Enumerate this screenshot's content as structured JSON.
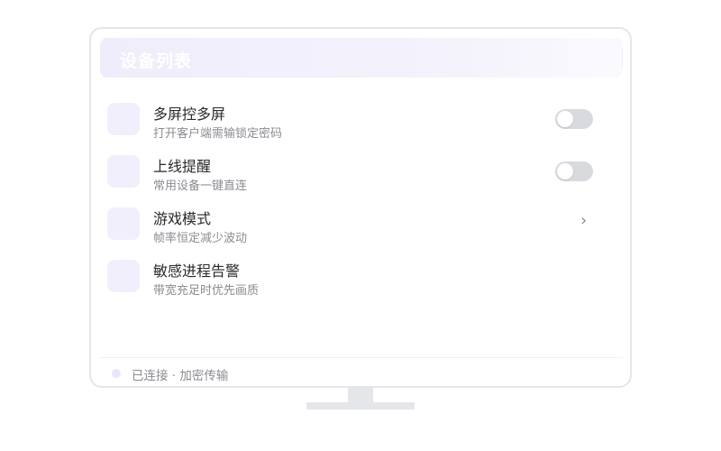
{
  "header": {
    "title": "设备列表"
  },
  "items": [
    {
      "title": "多屏控多屏",
      "subtitle": "打开客户端需输锁定密码",
      "control": "toggle",
      "on": false
    },
    {
      "title": "上线提醒",
      "subtitle": "常用设备一键直连",
      "control": "toggle",
      "on": false
    },
    {
      "title": "游戏模式",
      "subtitle": "帧率恒定减少波动",
      "control": "chevron",
      "chevron_glyph": "›"
    },
    {
      "title": "敏感进程告警",
      "subtitle": "带宽充足时优先画质",
      "control": "none"
    }
  ],
  "footer": {
    "status": "已连接 · 加密传输"
  },
  "colors": {
    "accent_tint": "#f1effc",
    "toggle_off": "#d8dade",
    "frame": "#e4e6ea"
  },
  "icons": {
    "toggle": "toggle-switch",
    "chevron": "chevron-right-icon",
    "status": "status-dot-icon"
  }
}
